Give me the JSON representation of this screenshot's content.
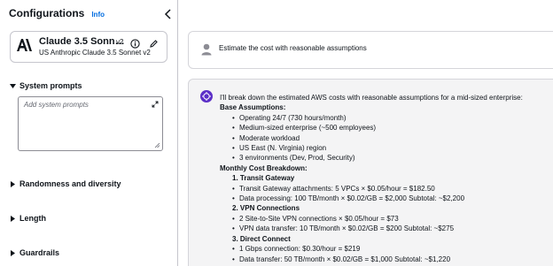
{
  "sidebar": {
    "title": "Configurations",
    "info_link": "Info",
    "model": {
      "name": "Claude 3.5 Sonn…",
      "version": "v2",
      "subtitle": "US Anthropic Claude 3.5 Sonnet v2"
    },
    "system_prompts": {
      "label": "System prompts",
      "placeholder": "Add system prompts"
    },
    "sections": [
      {
        "label": "Randomness and diversity"
      },
      {
        "label": "Length"
      },
      {
        "label": "Guardrails"
      }
    ]
  },
  "chat": {
    "user_message": "Estimate the cost with reasonable assumptions",
    "response": {
      "intro": "I'll break down the estimated AWS costs with reasonable assumptions for a mid-sized enterprise:",
      "assumptions_heading": "Base Assumptions:",
      "assumptions": [
        "Operating 24/7 (730 hours/month)",
        "Medium-sized enterprise (~500 employees)",
        "Moderate workload",
        "US East (N. Virginia) region",
        "3 environments (Dev, Prod, Security)"
      ],
      "breakdown_heading": "Monthly Cost Breakdown:",
      "items": [
        {
          "title": "1. Transit Gateway",
          "lines": [
            "Transit Gateway attachments: 5 VPCs × $0.05/hour = $182.50",
            "Data processing: 100 TB/month × $0.02/GB = $2,000 Subtotal: ~$2,200"
          ]
        },
        {
          "title": "2. VPN Connections",
          "lines": [
            "2 Site-to-Site VPN connections × $0.05/hour = $73",
            "VPN data transfer: 10 TB/month × $0.02/GB = $200 Subtotal: ~$275"
          ]
        },
        {
          "title": "3. Direct Connect",
          "lines": [
            "1 Gbps connection: $0.30/hour = $219",
            "Data transfer: 50 TB/month × $0.02/GB = $1,000 Subtotal: ~$1,220"
          ]
        }
      ]
    }
  }
}
